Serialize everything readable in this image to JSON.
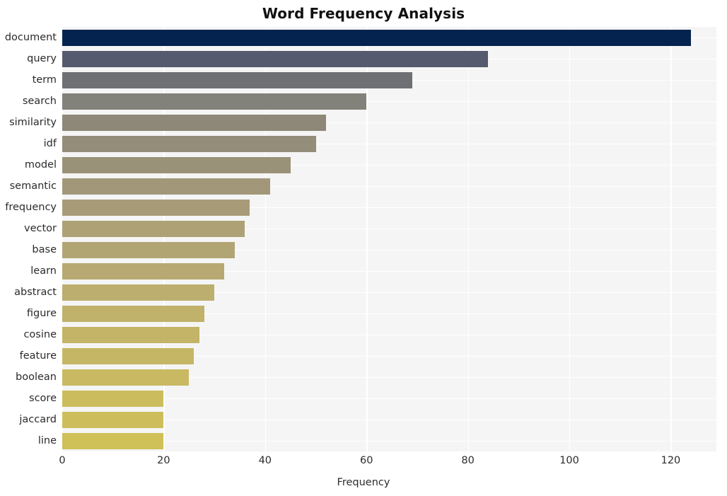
{
  "figure": {
    "title": "Word Frequency Analysis",
    "background": "#ffffff",
    "plot_background": "#f5f5f5",
    "grid_color": "#ffffff"
  },
  "axis": {
    "xlabel": "Frequency",
    "ylabel": "",
    "xticks": [
      "0",
      "20",
      "40",
      "60",
      "80",
      "100",
      "120"
    ]
  },
  "chart_data": {
    "type": "bar",
    "orientation": "horizontal",
    "title": "Word Frequency Analysis",
    "xlabel": "Frequency",
    "ylabel": "",
    "grid": true,
    "legend": "none",
    "xlim": [
      0,
      129
    ],
    "xticks": [
      0,
      20,
      40,
      60,
      80,
      100,
      120
    ],
    "categories": [
      "document",
      "query",
      "term",
      "search",
      "similarity",
      "idf",
      "model",
      "semantic",
      "frequency",
      "vector",
      "base",
      "learn",
      "abstract",
      "figure",
      "cosine",
      "feature",
      "boolean",
      "score",
      "jaccard",
      "line"
    ],
    "values": [
      124,
      84,
      69,
      60,
      52,
      50,
      45,
      41,
      37,
      36,
      34,
      32,
      30,
      28,
      27,
      26,
      25,
      20,
      20,
      20
    ],
    "colors": [
      "#04234f",
      "#555a6e",
      "#6f7073",
      "#82817a",
      "#8d8877",
      "#938d79",
      "#9a9278",
      "#a29879",
      "#a89c78",
      "#aea176",
      "#b2a574",
      "#b7a971",
      "#bcae6e",
      "#c0b16b",
      "#c3b468",
      "#c5b665",
      "#c8b962",
      "#cbbc5e",
      "#cdbe5b",
      "#cfc058"
    ]
  }
}
